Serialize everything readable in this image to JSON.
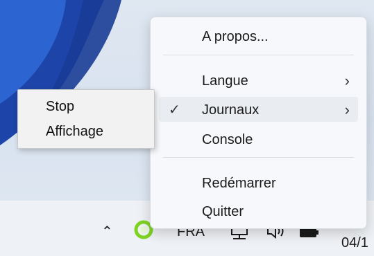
{
  "main_menu": {
    "items": [
      {
        "label": "A propos...",
        "submenu": false,
        "checked": false
      },
      {
        "label": "Langue",
        "submenu": true,
        "checked": false
      },
      {
        "label": "Journaux",
        "submenu": true,
        "checked": true
      },
      {
        "label": "Console",
        "submenu": false,
        "checked": false
      },
      {
        "label": "Redémarrer",
        "submenu": false,
        "checked": false
      },
      {
        "label": "Quitter",
        "submenu": false,
        "checked": false
      }
    ]
  },
  "sub_menu": {
    "items": [
      {
        "label": "Stop"
      },
      {
        "label": "Affichage"
      }
    ]
  },
  "taskbar": {
    "language": "FRA",
    "clock": "04/1",
    "icons": [
      "chevron-up-icon",
      "app-tray-icon",
      "network-icon",
      "volume-icon",
      "battery-icon"
    ]
  },
  "glyphs": {
    "chevron_right": "›",
    "check": "✓",
    "chevron_up": "⌃"
  },
  "colors": {
    "wallpaper_blue": "#1f4fb8",
    "tray_app_green": "#7ed321"
  }
}
